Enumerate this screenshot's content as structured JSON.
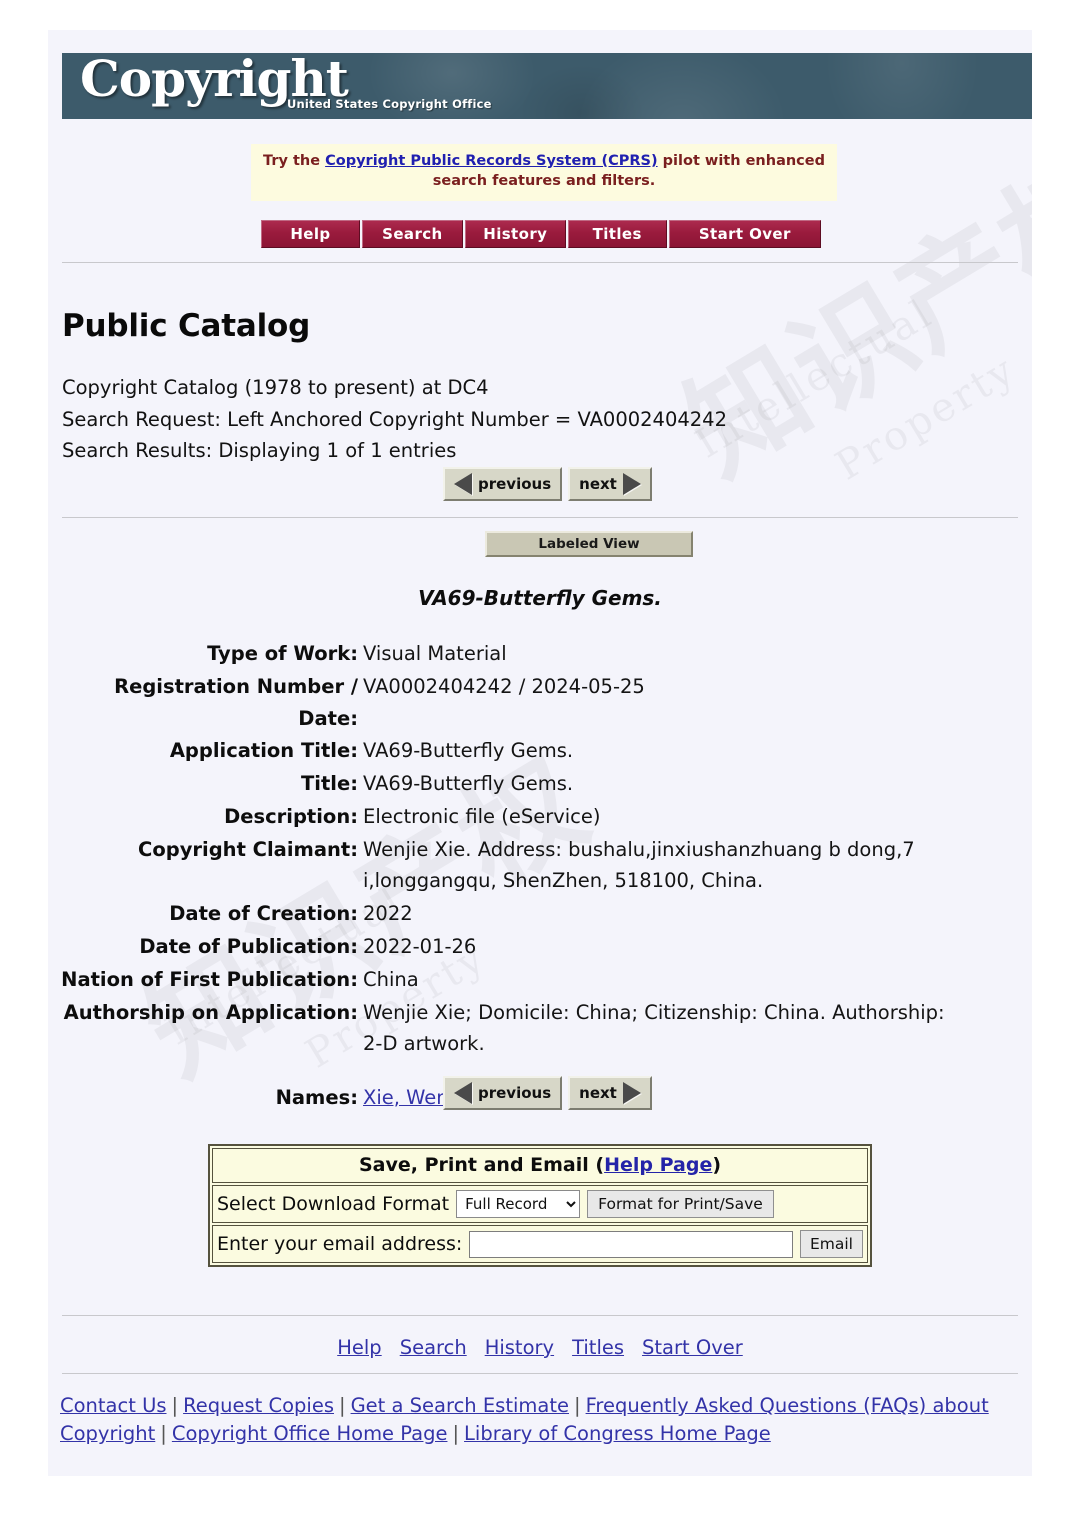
{
  "banner": {
    "title": "Copyright",
    "subtitle": "United States Copyright Office",
    "bg_color": "#3d5b6b"
  },
  "notice": {
    "prefix": "Try the ",
    "link": "Copyright Public Records System (CPRS)",
    "suffix": " pilot with enhanced search features and filters.",
    "bg_color": "#fdfbdf",
    "text_color": "#7a1f1f",
    "link_color": "#2020b0"
  },
  "topnav": {
    "accent_color": "#9e1b40",
    "items": [
      {
        "label": "Help"
      },
      {
        "label": "Search"
      },
      {
        "label": "History"
      },
      {
        "label": "Titles"
      },
      {
        "label": "Start Over"
      }
    ]
  },
  "page_title": "Public Catalog",
  "search_meta": {
    "catalog": " Copyright Catalog (1978 to present) at DC4",
    "request": "Search Request: Left Anchored Copyright Number = VA0002404242",
    "results": "Search Results: Displaying 1 of 1 entries"
  },
  "pager": {
    "previous_label": "previous",
    "next_label": "next"
  },
  "view_toggle": {
    "label": "Labeled View"
  },
  "record": {
    "title": "VA69-Butterfly Gems.",
    "fields": [
      {
        "label": "Type of Work:",
        "value": "Visual Material"
      },
      {
        "label": "Registration Number / Date:",
        "value": "VA0002404242 / 2024-05-25"
      },
      {
        "label": "Application Title:",
        "value": "VA69-Butterfly Gems."
      },
      {
        "label": "Title:",
        "value": "VA69-Butterfly Gems."
      },
      {
        "label": "Description:",
        "value": "Electronic file (eService)"
      },
      {
        "label": "Copyright Claimant:",
        "value": "Wenjie Xie. Address: bushalu,jinxiushanzhuang b dong,7 i,longgangqu, ShenZhen, 518100, China."
      },
      {
        "label": "Date of Creation:",
        "value": "2022"
      },
      {
        "label": "Date of Publication:",
        "value": "2022-01-26"
      },
      {
        "label": "Nation of First Publication:",
        "value": "China"
      },
      {
        "label": "Authorship on Application:",
        "value": "Wenjie Xie; Domicile: China; Citizenship: China. Authorship: 2-D artwork."
      }
    ],
    "names_label": "Names:",
    "names_link": "Xie, Wenjie"
  },
  "save_print_email": {
    "header_text": "Save, Print and Email (",
    "header_link": "Help Page",
    "header_close": ")",
    "download_label": "Select Download Format",
    "format_selected": "Full Record",
    "format_options": [
      "Full Record"
    ],
    "format_button": "Format for Print/Save",
    "email_label": "Enter your email address:",
    "email_value": "",
    "email_placeholder": "",
    "email_button": "Email",
    "bg_color": "#fbfbe0"
  },
  "footer_nav": [
    {
      "label": "Help"
    },
    {
      "label": "Search"
    },
    {
      "label": "History"
    },
    {
      "label": "Titles"
    },
    {
      "label": "Start Over"
    }
  ],
  "footer_links": {
    "contact": "Contact Us",
    "request_copies": "Request Copies",
    "search_estimate": "Get a Search Estimate",
    "faqs": "Frequently Asked Questions (FAQs) about Copyright",
    "home": "Copyright Office Home Page",
    "loc": "Library of Congress Home Page",
    "separator": "|"
  },
  "watermark": {
    "cn": "知识产权",
    "en_1": "Intellectual",
    "en_2": "Property"
  }
}
